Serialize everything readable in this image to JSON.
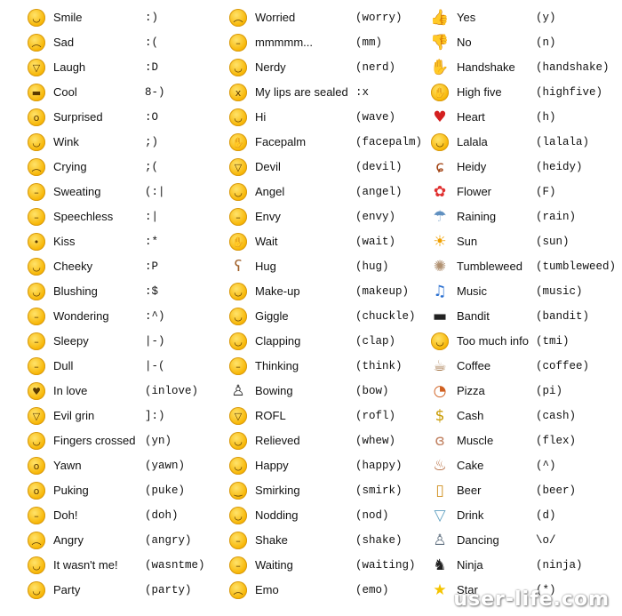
{
  "columns": [
    [
      {
        "name": "Smile",
        "code": ":)",
        "icon": "smile-face",
        "glyph": "◡"
      },
      {
        "name": "Sad",
        "code": ":(",
        "icon": "sad-face",
        "glyph": "︵"
      },
      {
        "name": "Laugh",
        "code": ":D",
        "icon": "laugh-face",
        "glyph": "▽"
      },
      {
        "name": "Cool",
        "code": "8-)",
        "icon": "cool-face",
        "glyph": "▬"
      },
      {
        "name": "Surprised",
        "code": ":O",
        "icon": "surprised-face",
        "glyph": "o"
      },
      {
        "name": "Wink",
        "code": ";)",
        "icon": "wink-face",
        "glyph": "◡"
      },
      {
        "name": "Crying",
        "code": ";(",
        "icon": "crying-face",
        "glyph": "︵"
      },
      {
        "name": "Sweating",
        "code": "(:|",
        "icon": "sweating-face",
        "glyph": "–"
      },
      {
        "name": "Speechless",
        "code": ":|",
        "icon": "speechless-face",
        "glyph": "–"
      },
      {
        "name": "Kiss",
        "code": ":*",
        "icon": "kiss-face",
        "glyph": "•"
      },
      {
        "name": "Cheeky",
        "code": ":P",
        "icon": "cheeky-face",
        "glyph": "◡"
      },
      {
        "name": "Blushing",
        "code": ":$",
        "icon": "blushing-face",
        "glyph": "◡"
      },
      {
        "name": "Wondering",
        "code": ":^)",
        "icon": "wondering-face",
        "glyph": "–"
      },
      {
        "name": "Sleepy",
        "code": "|-)",
        "icon": "sleepy-face",
        "glyph": "–"
      },
      {
        "name": "Dull",
        "code": "|-(",
        "icon": "dull-face",
        "glyph": "–"
      },
      {
        "name": "In love",
        "code": "(inlove)",
        "icon": "in-love-face",
        "glyph": "♥"
      },
      {
        "name": "Evil grin",
        "code": "]:)",
        "icon": "evil-grin-face",
        "glyph": "▽"
      },
      {
        "name": "Fingers crossed",
        "code": "(yn)",
        "icon": "fingers-crossed-face",
        "glyph": "◡"
      },
      {
        "name": "Yawn",
        "code": "(yawn)",
        "icon": "yawn-face",
        "glyph": "o"
      },
      {
        "name": "Puking",
        "code": "(puke)",
        "icon": "puking-face",
        "glyph": "o"
      },
      {
        "name": "Doh!",
        "code": "(doh)",
        "icon": "doh-face",
        "glyph": "–"
      },
      {
        "name": "Angry",
        "code": "(angry)",
        "icon": "angry-face",
        "glyph": "︵"
      },
      {
        "name": "It wasn't me!",
        "code": "(wasntme)",
        "icon": "wasntme-face",
        "glyph": "◡"
      },
      {
        "name": "Party",
        "code": "(party)",
        "icon": "party-face",
        "glyph": "◡"
      }
    ],
    [
      {
        "name": "Worried",
        "code": "(worry)",
        "icon": "worried-face",
        "glyph": "︵"
      },
      {
        "name": "mmmmm...",
        "code": "(mm)",
        "icon": "mmm-face",
        "glyph": "–"
      },
      {
        "name": "Nerdy",
        "code": "(nerd)",
        "icon": "nerdy-face",
        "glyph": "◡"
      },
      {
        "name": "My lips are sealed",
        "code": ":x",
        "icon": "lips-sealed-face",
        "glyph": "x"
      },
      {
        "name": "Hi",
        "code": "(wave)",
        "icon": "wave-face",
        "glyph": "◡"
      },
      {
        "name": "Facepalm",
        "code": "(facepalm)",
        "icon": "facepalm-face",
        "glyph": "✋"
      },
      {
        "name": "Devil",
        "code": "(devil)",
        "icon": "devil-face",
        "glyph": "▽"
      },
      {
        "name": "Angel",
        "code": "(angel)",
        "icon": "angel-face",
        "glyph": "◡"
      },
      {
        "name": "Envy",
        "code": "(envy)",
        "icon": "envy-face",
        "glyph": "–"
      },
      {
        "name": "Wait",
        "code": "(wait)",
        "icon": "wait-face",
        "glyph": "✋"
      },
      {
        "name": "Hug",
        "code": "(hug)",
        "icon": "hug-bear",
        "glyph": "ʕ"
      },
      {
        "name": "Make-up",
        "code": "(makeup)",
        "icon": "makeup-face",
        "glyph": "◡"
      },
      {
        "name": "Giggle",
        "code": "(chuckle)",
        "icon": "giggle-face",
        "glyph": "◡"
      },
      {
        "name": "Clapping",
        "code": "(clap)",
        "icon": "clapping-face",
        "glyph": "◡"
      },
      {
        "name": "Thinking",
        "code": "(think)",
        "icon": "thinking-face",
        "glyph": "–"
      },
      {
        "name": "Bowing",
        "code": "(bow)",
        "icon": "bowing-person",
        "glyph": "♙"
      },
      {
        "name": "ROFL",
        "code": "(rofl)",
        "icon": "rofl-face",
        "glyph": "▽"
      },
      {
        "name": "Relieved",
        "code": "(whew)",
        "icon": "relieved-face",
        "glyph": "◡"
      },
      {
        "name": "Happy",
        "code": "(happy)",
        "icon": "happy-face",
        "glyph": "◡"
      },
      {
        "name": "Smirking",
        "code": "(smirk)",
        "icon": "smirking-face",
        "glyph": "‿"
      },
      {
        "name": "Nodding",
        "code": "(nod)",
        "icon": "nodding-face",
        "glyph": "◡"
      },
      {
        "name": "Shake",
        "code": "(shake)",
        "icon": "shake-face",
        "glyph": "–"
      },
      {
        "name": "Waiting",
        "code": "(waiting)",
        "icon": "waiting-face",
        "glyph": "–"
      },
      {
        "name": "Emo",
        "code": "(emo)",
        "icon": "emo-face",
        "glyph": "︵"
      }
    ],
    [
      {
        "name": "Yes",
        "code": "(y)",
        "icon": "thumbs-up",
        "glyph": "👍"
      },
      {
        "name": "No",
        "code": "(n)",
        "icon": "thumbs-down",
        "glyph": "👎"
      },
      {
        "name": "Handshake",
        "code": "(handshake)",
        "icon": "handshake",
        "glyph": "✋"
      },
      {
        "name": "High five",
        "code": "(highfive)",
        "icon": "high-five-face",
        "glyph": "✋"
      },
      {
        "name": "Heart",
        "code": "(h)",
        "icon": "heart",
        "glyph": "♥"
      },
      {
        "name": "Lalala",
        "code": "(lalala)",
        "icon": "lalala-face",
        "glyph": "◡"
      },
      {
        "name": "Heidy",
        "code": "(heidy)",
        "icon": "squirrel",
        "glyph": "ɕ"
      },
      {
        "name": "Flower",
        "code": "(F)",
        "icon": "flower",
        "glyph": "✿"
      },
      {
        "name": "Raining",
        "code": "(rain)",
        "icon": "rain-cloud",
        "glyph": "☂"
      },
      {
        "name": "Sun",
        "code": "(sun)",
        "icon": "sun",
        "glyph": "☀"
      },
      {
        "name": "Tumbleweed",
        "code": "(tumbleweed)",
        "icon": "tumbleweed",
        "glyph": "✺"
      },
      {
        "name": "Music",
        "code": "(music)",
        "icon": "music-note",
        "glyph": "♫"
      },
      {
        "name": "Bandit",
        "code": "(bandit)",
        "icon": "bandit",
        "glyph": "▬"
      },
      {
        "name": "Too much info",
        "code": "(tmi)",
        "icon": "tmi-face",
        "glyph": "◡"
      },
      {
        "name": "Coffee",
        "code": "(coffee)",
        "icon": "coffee-cup",
        "glyph": "☕"
      },
      {
        "name": "Pizza",
        "code": "(pi)",
        "icon": "pizza",
        "glyph": "◔"
      },
      {
        "name": "Cash",
        "code": "(cash)",
        "icon": "cash",
        "glyph": "$"
      },
      {
        "name": "Muscle",
        "code": "(flex)",
        "icon": "muscle",
        "glyph": "ɞ"
      },
      {
        "name": "Cake",
        "code": "(^)",
        "icon": "cake",
        "glyph": "♨"
      },
      {
        "name": "Beer",
        "code": "(beer)",
        "icon": "beer",
        "glyph": "▯"
      },
      {
        "name": "Drink",
        "code": "(d)",
        "icon": "cocktail",
        "glyph": "▽"
      },
      {
        "name": "Dancing",
        "code": "\\o/",
        "icon": "dancing-person",
        "glyph": "♙"
      },
      {
        "name": "Ninja",
        "code": "(ninja)",
        "icon": "ninja",
        "glyph": "♞"
      },
      {
        "name": "Star",
        "code": "(*)",
        "icon": "star",
        "glyph": "★"
      }
    ]
  ],
  "symbol_colors": {
    "heart": "#d42020",
    "star": "#f5c400",
    "music-note": "#2a6fd0",
    "cash": "#c89a00",
    "flower": "#e03030",
    "sun": "#f0a000",
    "thumbs-up": "#e8b070",
    "thumbs-down": "#e8b070",
    "handshake": "#d8a070",
    "coffee-cup": "#a07040",
    "pizza": "#d06020",
    "cocktail": "#60a0c0",
    "ninja": "#222222",
    "bandit": "#222222",
    "dancing-person": "#607080",
    "bowing-person": "#333333",
    "rain-cloud": "#6090c0",
    "beer": "#d09020",
    "cake": "#b06030",
    "tumbleweed": "#b09070",
    "squirrel": "#a04010",
    "muscle": "#c08060",
    "hug-bear": "#a0602a"
  },
  "watermark": "user-life.com"
}
